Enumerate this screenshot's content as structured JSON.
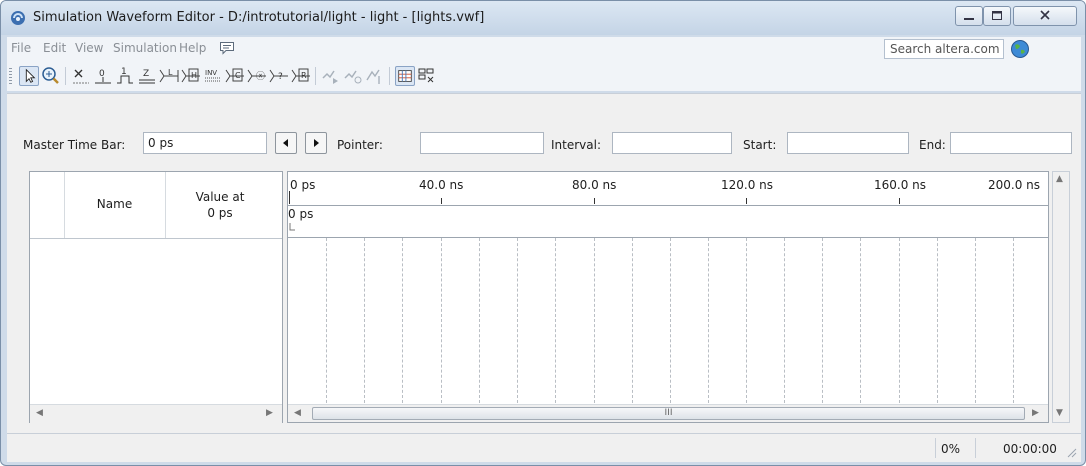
{
  "window": {
    "title": "Simulation Waveform Editor - D:/introtutorial/light - light - [lights.vwf]",
    "icon": "quartus-app-icon"
  },
  "menu": {
    "items": [
      "File",
      "Edit",
      "View",
      "Simulation",
      "Help"
    ],
    "search_placeholder": "Search altera.com"
  },
  "toolbar": {
    "tools": [
      "selection-tool-icon",
      "zoom-tool-icon",
      "force-unknown-icon",
      "force-low-icon",
      "force-high-icon",
      "force-high-impedance-icon",
      "force-weak-low-icon",
      "force-weak-high-icon",
      "invert-icon",
      "count-value-icon",
      "overwrite-clock-icon",
      "random-values-icon",
      "forward-simulation-icon",
      "run-functional-simulation-icon",
      "run-timing-simulation-icon",
      "snap-to-grid-icon",
      "sort-icon"
    ]
  },
  "timebar": {
    "master_label": "Master Time Bar:",
    "master_value": "0 ps",
    "pointer_label": "Pointer:",
    "pointer_value": "",
    "interval_label": "Interval:",
    "interval_value": "",
    "start_label": "Start:",
    "start_value": "",
    "end_label": "End:",
    "end_value": ""
  },
  "signals": {
    "name_header": "Name",
    "value_header_line1": "Value at",
    "value_header_line2": "0 ps"
  },
  "waveform": {
    "ruler_labels": [
      "0 ps",
      "40.0 ns",
      "80.0 ns",
      "120.0 ns",
      "160.0 ns",
      "200.0 ns"
    ],
    "cursor_label": "0 ps"
  },
  "scroll": {
    "thumb_marker": "III"
  },
  "status": {
    "progress": "0%",
    "elapsed": "00:00:00"
  },
  "colors": {
    "titlebar": "#c4d4e6",
    "frame": "#cfdbe9",
    "panel": "#f0f0f0"
  }
}
